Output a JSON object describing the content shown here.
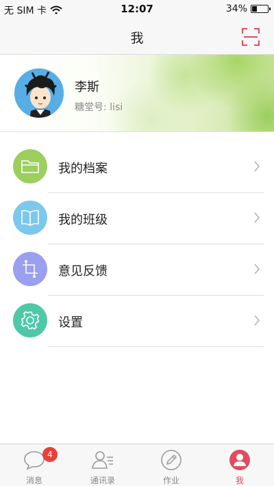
{
  "status_bar": {
    "carrier": "无 SIM 卡",
    "time": "12:07",
    "battery_percent": "34%",
    "battery_level": 0.34
  },
  "nav": {
    "title": "我",
    "right_icon": "scan-icon",
    "accent": "#e24b5e"
  },
  "profile": {
    "name": "李斯",
    "id_label": "糖堂号: lisi"
  },
  "menu": [
    {
      "label": "我的档案",
      "icon": "folder-icon",
      "color": "#9ccf5e"
    },
    {
      "label": "我的班级",
      "icon": "book-icon",
      "color": "#7cc8ec"
    },
    {
      "label": "意见反馈",
      "icon": "crop-icon",
      "color": "#9a9ff0"
    },
    {
      "label": "设置",
      "icon": "gear-icon",
      "color": "#4fc8a8"
    }
  ],
  "tabs": [
    {
      "label": "消息",
      "icon": "chat-icon",
      "badge": "4"
    },
    {
      "label": "通讯录",
      "icon": "contacts-icon"
    },
    {
      "label": "作业",
      "icon": "pencil-icon"
    },
    {
      "label": "我",
      "icon": "user-icon",
      "active": true
    }
  ]
}
